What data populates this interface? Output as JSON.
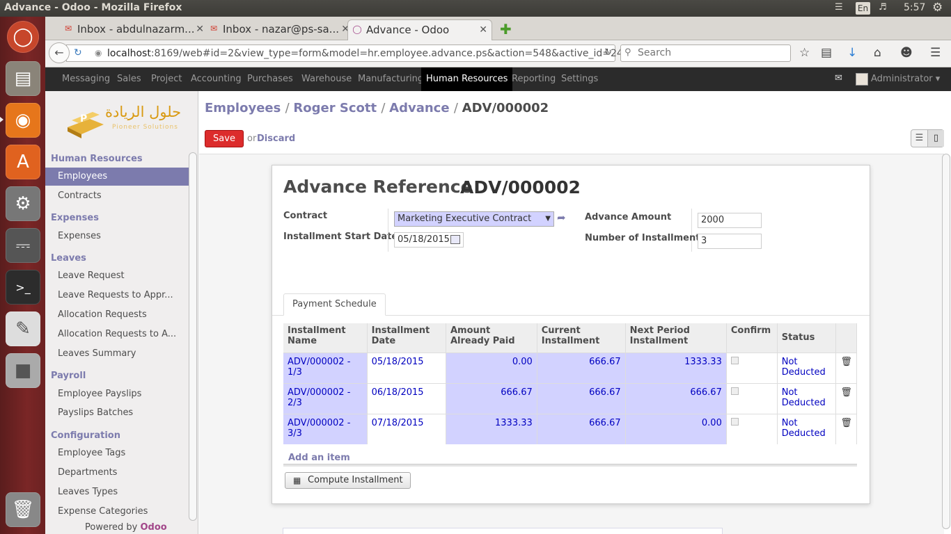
{
  "os": {
    "window_title": "Advance - Odoo - Mozilla Firefox",
    "tray": {
      "lang": "En",
      "clock": "5:57"
    }
  },
  "browser": {
    "tabs": [
      {
        "label": "Inbox - abdulnazarm...",
        "icon": "gmail-icon"
      },
      {
        "label": "Inbox - nazar@ps-sa...",
        "icon": "gmail-icon"
      },
      {
        "label": "Advance - Odoo",
        "icon": "odoo-icon"
      }
    ],
    "url": {
      "host": "localhost",
      "rest": ":8169/web#id=2&view_type=form&model=hr.employee.advance.ps&action=548&active_id=24"
    },
    "search_placeholder": "Search"
  },
  "topmenu": {
    "items": [
      "Messaging",
      "Sales",
      "Project",
      "Accounting",
      "Purchases",
      "Warehouse",
      "Manufacturing",
      "Human Resources",
      "Reporting",
      "Settings"
    ],
    "active": "Human Resources",
    "user": "Administrator"
  },
  "logo": {
    "arabic": "حلول الريادة",
    "sub": "Pioneer Solutions"
  },
  "sidebar": {
    "sections": [
      {
        "title": "Human Resources",
        "items": [
          "Employees",
          "Contracts"
        ]
      },
      {
        "title": "Expenses",
        "items": [
          "Expenses"
        ]
      },
      {
        "title": "Leaves",
        "items": [
          "Leave Request",
          "Leave Requests to Appr...",
          "Allocation Requests",
          "Allocation Requests to A...",
          "Leaves Summary"
        ]
      },
      {
        "title": "Payroll",
        "items": [
          "Employee Payslips",
          "Payslips Batches"
        ]
      },
      {
        "title": "Configuration",
        "items": [
          "Employee Tags",
          "Departments",
          "Leaves Types",
          "Expense Categories"
        ]
      }
    ],
    "active_item": "Employees",
    "powered_by": "Powered by",
    "powered_brand": "Odoo"
  },
  "breadcrumb": [
    "Employees",
    "Roger Scott",
    "Advance",
    "ADV/000002"
  ],
  "actions": {
    "save": "Save",
    "or": "or",
    "discard": "Discard"
  },
  "form": {
    "title_label": "Advance Reference",
    "reference": "ADV/000002",
    "contract_label": "Contract",
    "contract_value": "Marketing Executive Contract",
    "start_date_label": "Installment Start Date",
    "start_date_value": "05/18/2015",
    "amount_label": "Advance Amount",
    "amount_value": "2000",
    "installments_label": "Number of Installments",
    "installments_value": "3",
    "tab_label": "Payment Schedule",
    "add_item": "Add an item",
    "compute_button": "Compute Installment"
  },
  "schedule": {
    "columns": [
      "Installment Name",
      "Installment Date",
      "Amount Already Paid",
      "Current Installment",
      "Next Period Installment",
      "Confirm",
      "Status"
    ],
    "rows": [
      {
        "name": "ADV/000002 - 1/3",
        "date": "05/18/2015",
        "paid": "0.00",
        "current": "666.67",
        "next": "1333.33",
        "status": "Not Deducted"
      },
      {
        "name": "ADV/000002 - 2/3",
        "date": "06/18/2015",
        "paid": "666.67",
        "current": "666.67",
        "next": "666.67",
        "status": "Not Deducted"
      },
      {
        "name": "ADV/000002 - 3/3",
        "date": "07/18/2015",
        "paid": "1333.33",
        "current": "666.67",
        "next": "0.00",
        "status": "Not Deducted"
      }
    ]
  },
  "colors": {
    "accent": "#7c7bad",
    "save_red": "#dc2c2c",
    "highlight": "#d2d2ff",
    "topbar": "#2b2b2b"
  }
}
